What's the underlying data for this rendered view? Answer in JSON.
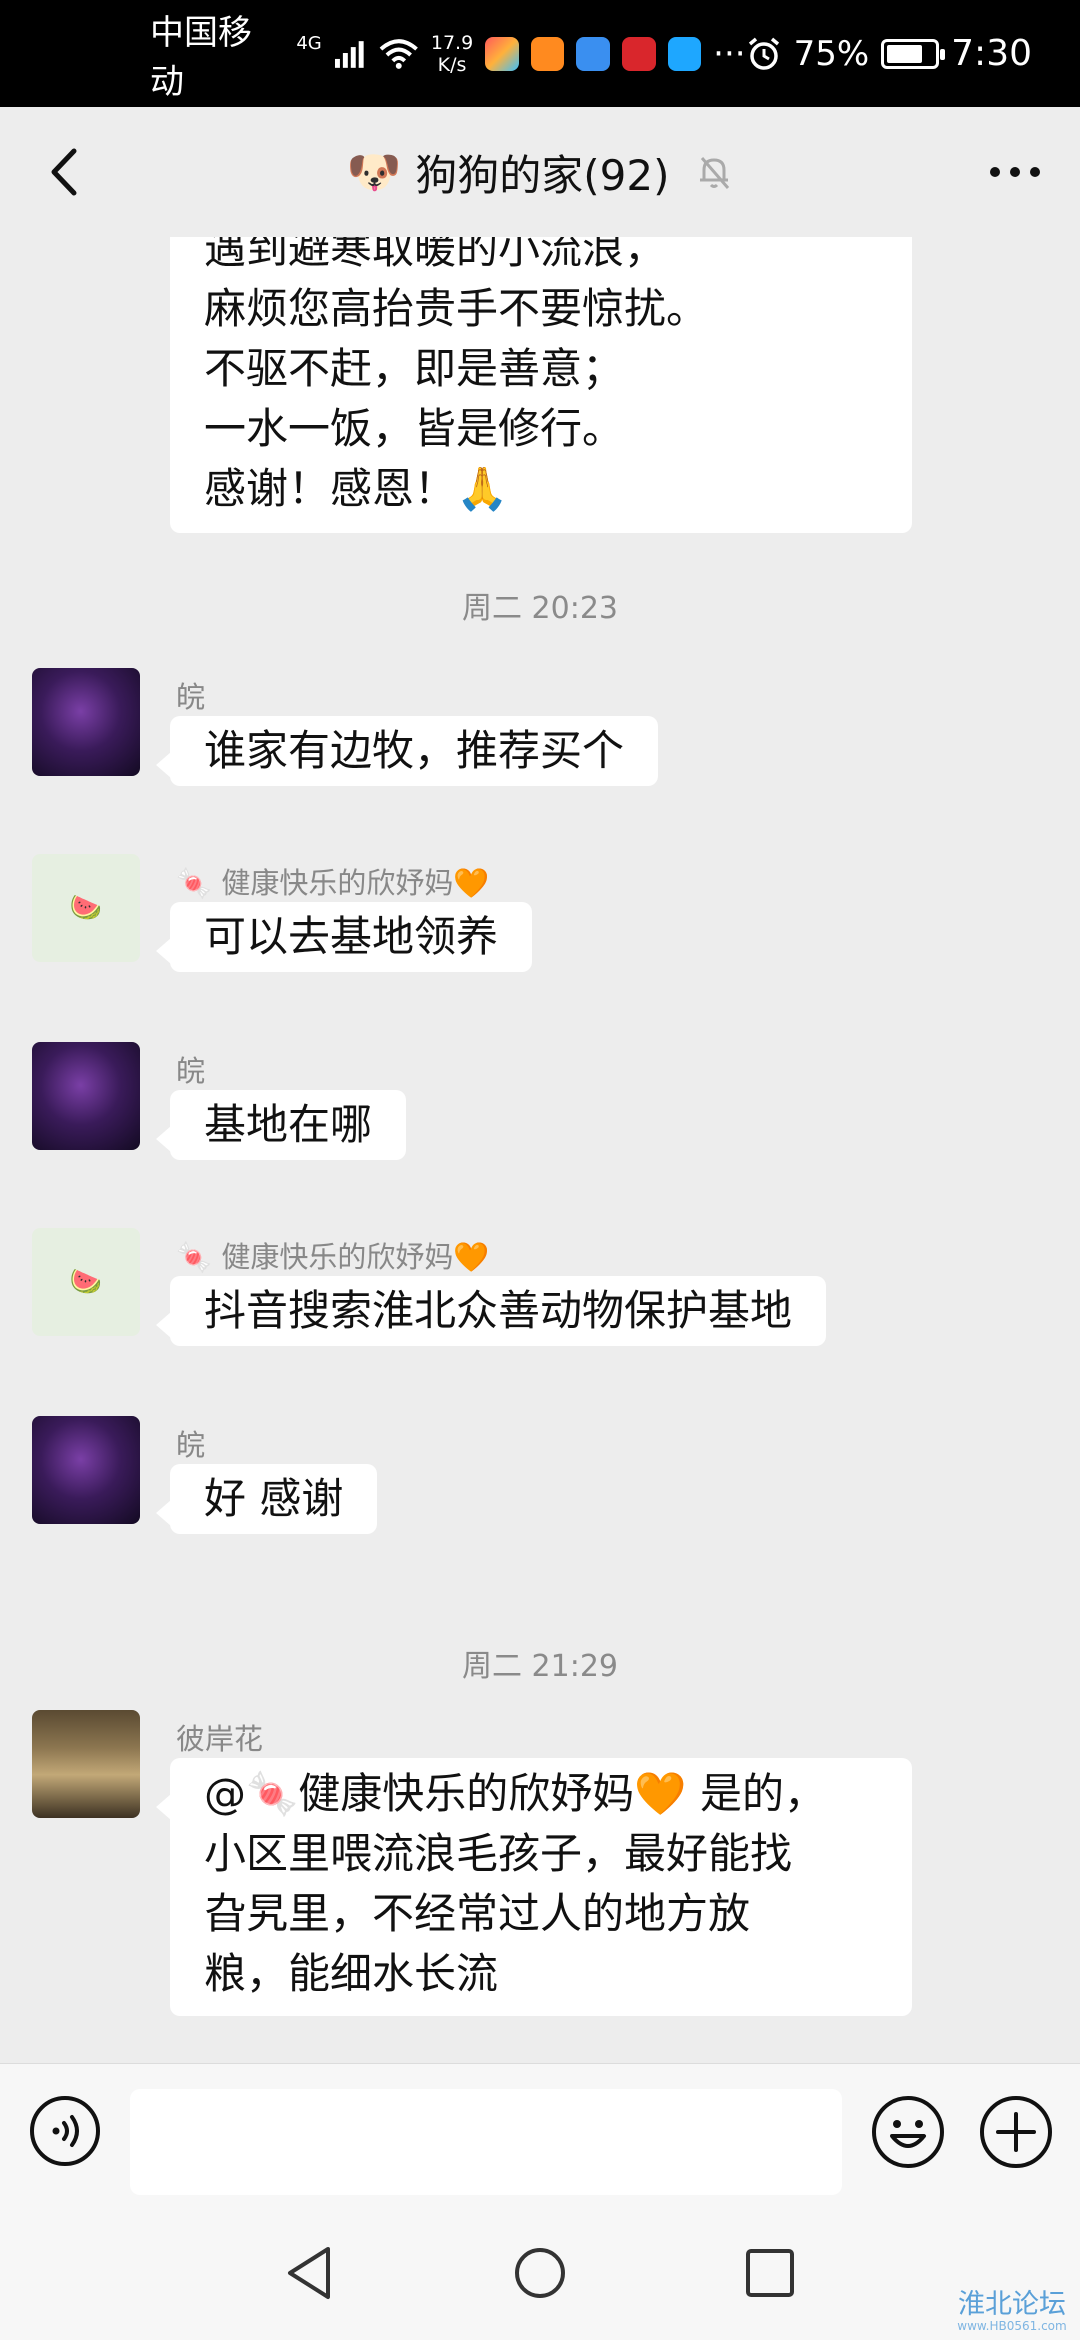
{
  "status_bar": {
    "carrier": "中国移动",
    "network": "4G",
    "speed_value": "17.9",
    "speed_unit": "K/s",
    "battery": "75%",
    "battery_level": 0.75,
    "time": "7:30",
    "more": "···"
  },
  "header": {
    "emoji": "🐶",
    "title": "狗狗的家(92)"
  },
  "messages": {
    "m0": {
      "lines": [
        "遇到避寒取暖的小流浪，",
        "麻烦您高抬贵手不要惊扰。",
        "不驱不赶，即是善意；",
        "一水一饭，皆是修行。",
        "感谢！感恩！🙏"
      ]
    },
    "sep1": "周二 20:23",
    "m1": {
      "sender": "皖",
      "text": "谁家有边牧，推荐买个"
    },
    "m2": {
      "sender": "🍬 健康快乐的欣妤妈🧡",
      "text": "可以去基地领养"
    },
    "m3": {
      "sender": "皖",
      "text": "基地在哪"
    },
    "m4": {
      "sender": "🍬 健康快乐的欣妤妈🧡",
      "text": "抖音搜索淮北众善动物保护基地"
    },
    "m5": {
      "sender": "皖",
      "text": "好 感谢"
    },
    "sep2": "周二 21:29",
    "m6": {
      "sender": "彼岸花",
      "lines": [
        "@🍬健康快乐的欣妤妈🧡 是的，",
        "小区里喂流浪毛孩子，最好能找",
        "旮旯里，不经常过人的地方放",
        "粮，能细水长流"
      ]
    },
    "avatar_glyph": "🍉"
  },
  "input": {
    "placeholder": ""
  },
  "watermark": {
    "main": "淮北论坛",
    "sub": "www.HB0561.com"
  }
}
